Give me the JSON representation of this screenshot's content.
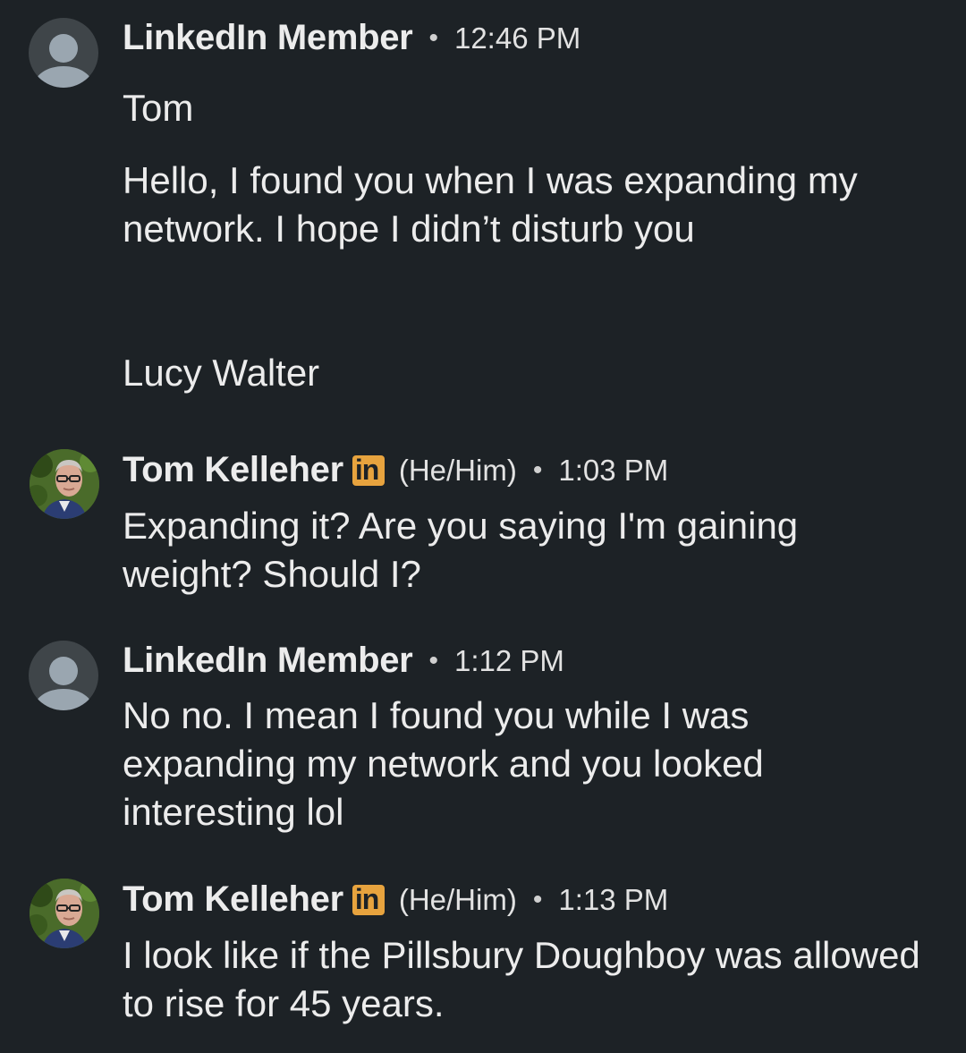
{
  "messages": [
    {
      "sender": "LinkedIn Member",
      "time": "12:46 PM",
      "lines": [
        "Tom",
        "Hello, I found you when I was expanding my network. I hope I didn’t disturb you",
        "Lucy Walter"
      ]
    },
    {
      "sender": "Tom Kelleher",
      "badge": "in",
      "pronouns": "(He/Him)",
      "time": "1:03 PM",
      "text": "Expanding it?  Are you saying I'm gaining weight?  Should I?"
    },
    {
      "sender": "LinkedIn Member",
      "time": "1:12 PM",
      "text": "No no. I mean I found you while I was expanding my network and you looked interesting lol"
    },
    {
      "sender": "Tom Kelleher",
      "badge": "in",
      "pronouns": "(He/Him)",
      "time": "1:13 PM",
      "text": "I look like if the Pillsbury Doughboy was allowed to rise for 45 years."
    }
  ],
  "separator": "•",
  "colors": {
    "background": "#1d2226",
    "text": "#ececec",
    "badge": "#e7a33e",
    "avatar_placeholder": "#9aa6b0"
  }
}
